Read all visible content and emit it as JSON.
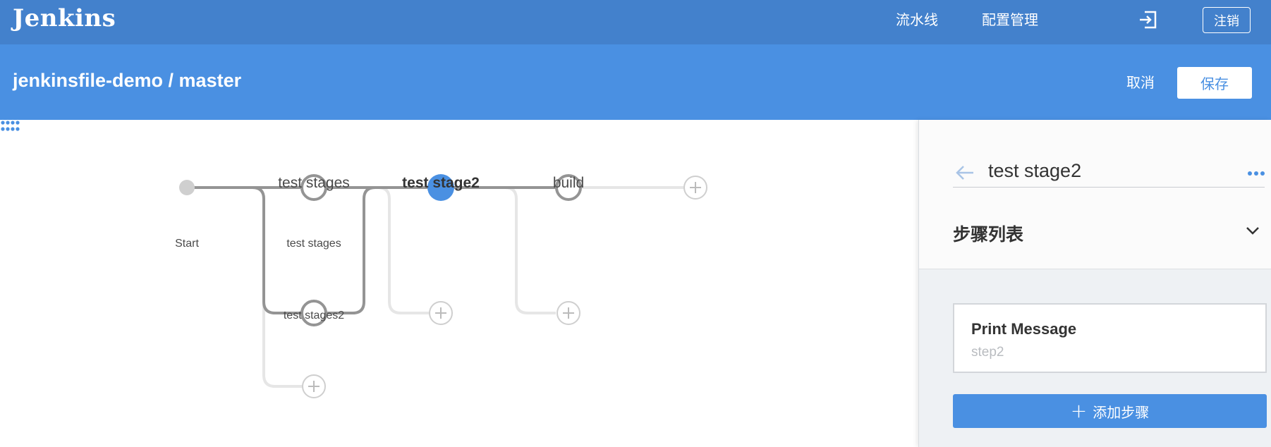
{
  "header": {
    "logo": "Jenkins",
    "nav": [
      "流水线",
      "配置管理"
    ],
    "logout_label": "注销"
  },
  "subheader": {
    "breadcrumb": "jenkinsfile-demo / master",
    "cancel_label": "取消",
    "save_label": "保存"
  },
  "pipeline": {
    "start_label": "Start",
    "stages": [
      {
        "title": "test stages",
        "parallel": [
          "test stages",
          "test stages2"
        ]
      },
      {
        "title": "test stage2",
        "selected": true
      },
      {
        "title": "build"
      }
    ]
  },
  "panel": {
    "stage_name": "test stage2",
    "steps_title": "步骤列表",
    "steps": [
      {
        "title": "Print Message",
        "subtitle": "step2"
      }
    ],
    "add_step_label": "添加步骤"
  },
  "colors": {
    "topbar": "#4381cc",
    "subbar": "#4a90e2",
    "selected_node": "#4a90e2",
    "edge": "#949494",
    "ghost_edge": "#e6e6e6"
  },
  "icons": {
    "exit": "exit-icon",
    "back": "arrow-left-icon",
    "more": "more-horizontal-icon",
    "chevron": "chevron-down-icon",
    "drag": "drag-handle-icon",
    "add": "plus-icon"
  }
}
